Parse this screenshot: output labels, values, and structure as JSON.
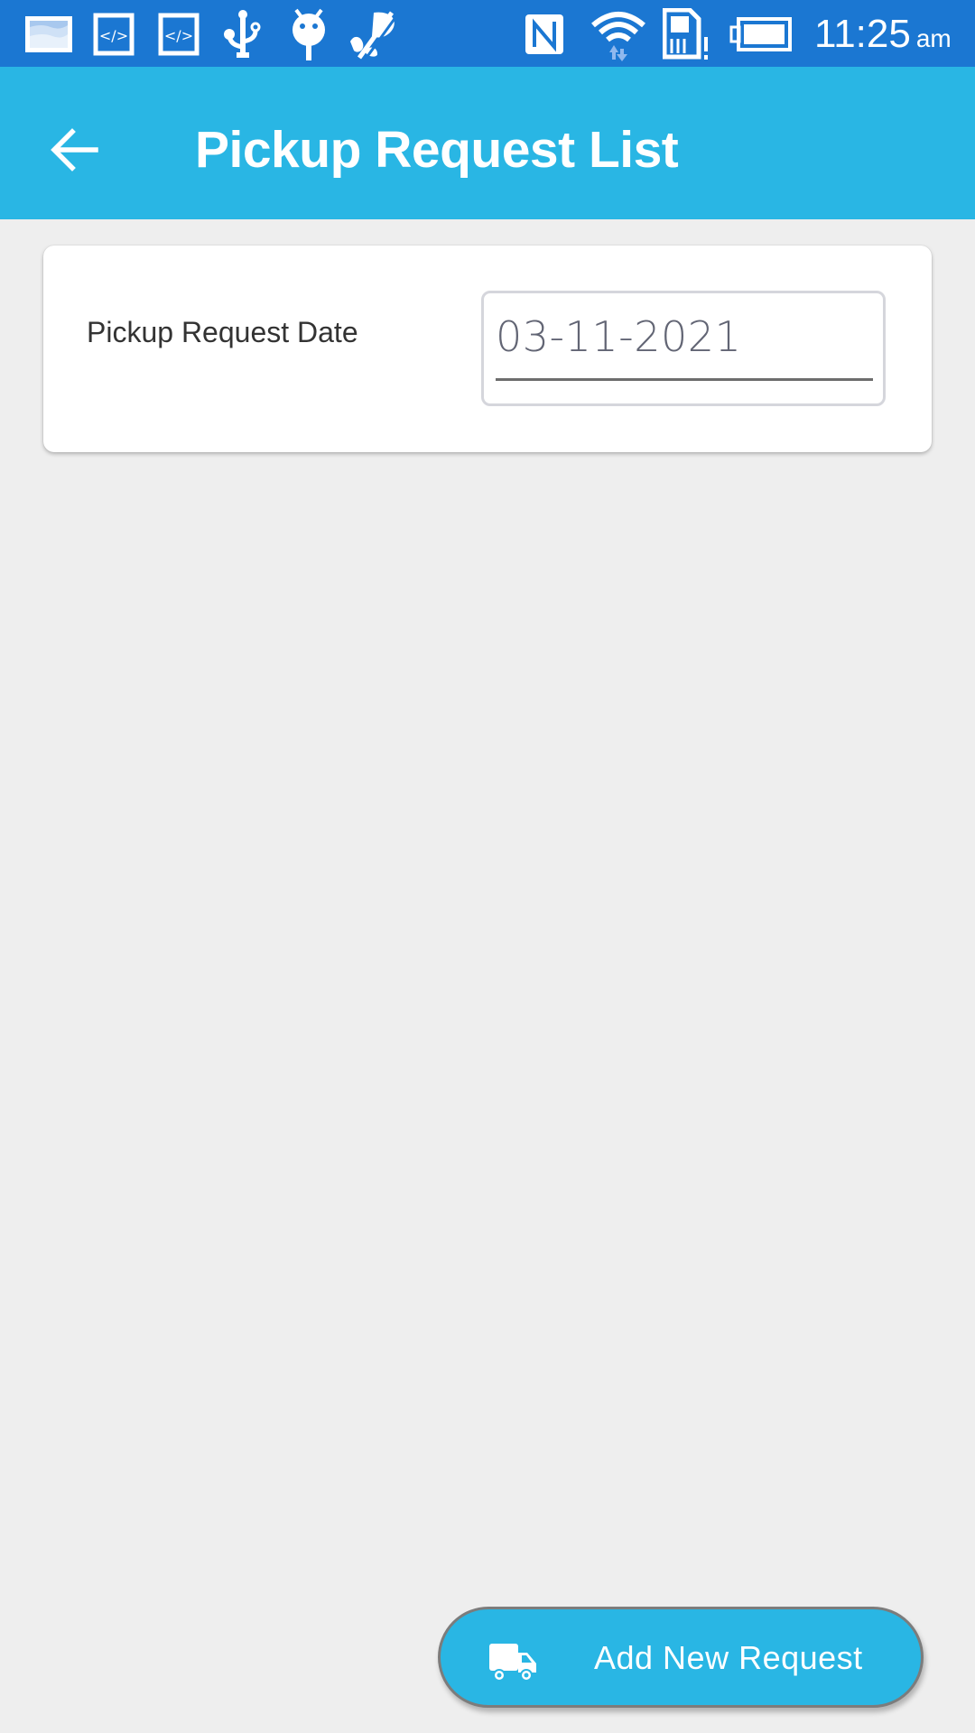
{
  "status_bar": {
    "left_icons": [
      "screenshot-icon",
      "code-icon",
      "code-icon",
      "usb-icon",
      "android-debug-icon",
      "no-location-icon"
    ],
    "right_icons": [
      "nfc-icon",
      "wifi-icon",
      "sim-alert-icon",
      "battery-icon"
    ],
    "time": "11:25",
    "ampm": "am"
  },
  "app_bar": {
    "back_icon": "arrow-left-icon",
    "title": "Pickup Request List"
  },
  "filter_card": {
    "label": "Pickup Request Date",
    "date_value": "03-11-2021"
  },
  "fab": {
    "icon": "truck-icon",
    "label": "Add New Request"
  },
  "colors": {
    "status_bar": "#1b77d2",
    "app_bar": "#29b6e4",
    "background": "#eeeeee",
    "fab": "#29b6e4"
  }
}
